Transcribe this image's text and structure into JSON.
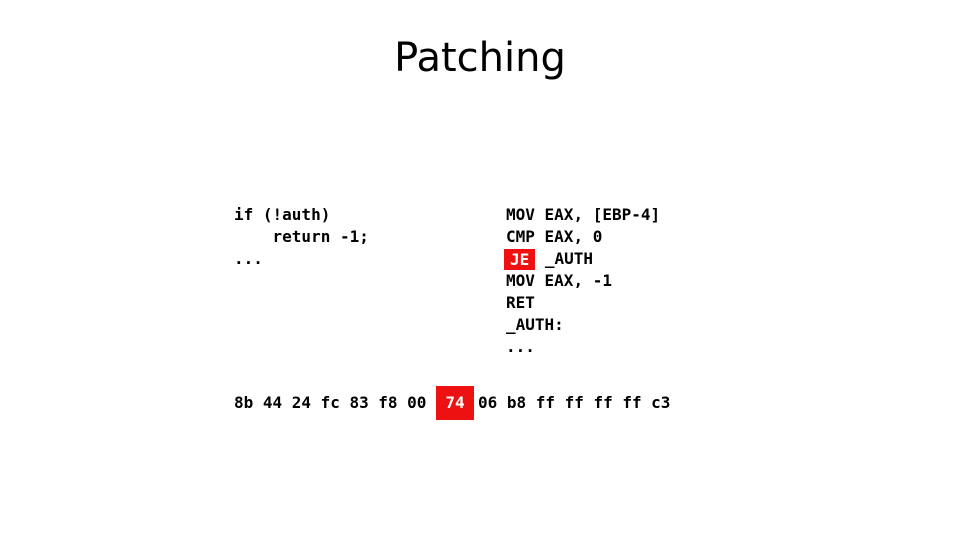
{
  "slide": {
    "title": "Patching",
    "background_color": "#ffffff",
    "text_color": "#000000",
    "highlight_color": "#ED1111",
    "highlight_text_color": "#ffffff"
  },
  "c_source": {
    "lines": [
      "if (!auth)",
      "    return -1;",
      "..."
    ]
  },
  "assembly": {
    "lines": [
      {
        "mnemonic": "MOV",
        "operands": " EAX, [EBP-4]",
        "highlighted": false
      },
      {
        "mnemonic": "CMP",
        "operands": " EAX, 0",
        "highlighted": false
      },
      {
        "mnemonic": "JE",
        "operands": " _AUTH",
        "highlighted": true
      },
      {
        "mnemonic": "MOV",
        "operands": " EAX, -1",
        "highlighted": false
      },
      {
        "mnemonic": "RET",
        "operands": "",
        "highlighted": false
      },
      {
        "mnemonic": "_AUTH:",
        "operands": "",
        "highlighted": false
      },
      {
        "mnemonic": "...",
        "operands": "",
        "highlighted": false
      }
    ]
  },
  "hex_bytes": [
    {
      "value": "8b",
      "highlighted": false
    },
    {
      "value": "44",
      "highlighted": false
    },
    {
      "value": "24",
      "highlighted": false
    },
    {
      "value": "fc",
      "highlighted": false
    },
    {
      "value": "83",
      "highlighted": false
    },
    {
      "value": "f8",
      "highlighted": false
    },
    {
      "value": "00",
      "highlighted": false
    },
    {
      "value": "74",
      "highlighted": true
    },
    {
      "value": "06",
      "highlighted": false
    },
    {
      "value": "b8",
      "highlighted": false
    },
    {
      "value": "ff",
      "highlighted": false
    },
    {
      "value": "ff",
      "highlighted": false
    },
    {
      "value": "ff",
      "highlighted": false
    },
    {
      "value": "ff",
      "highlighted": false
    },
    {
      "value": "c3",
      "highlighted": false
    }
  ]
}
